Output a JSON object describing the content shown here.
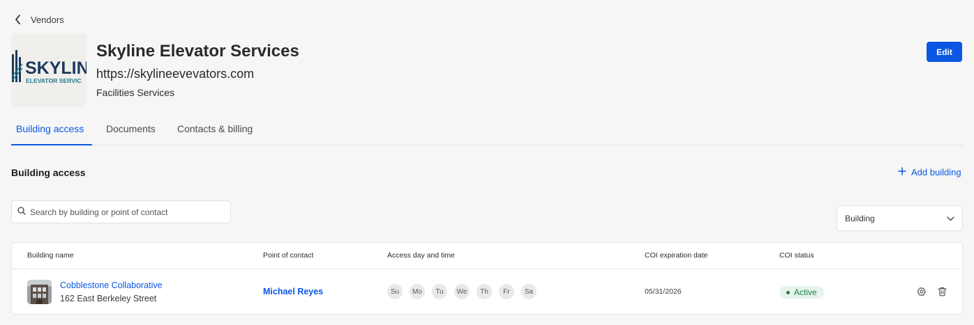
{
  "breadcrumb": {
    "back_label": "Vendors"
  },
  "vendor": {
    "logo_text_top": "SKYLIN",
    "logo_text_bottom": "ELEVATOR SERVIC",
    "name": "Skyline Elevator Services",
    "url": "https://skylineevevators.com",
    "category": "Facilities Services"
  },
  "header": {
    "edit_label": "Edit"
  },
  "tabs": [
    {
      "label": "Building access",
      "active": true
    },
    {
      "label": "Documents",
      "active": false
    },
    {
      "label": "Contacts & billing",
      "active": false
    }
  ],
  "section": {
    "title": "Building access",
    "add_label": "Add building"
  },
  "search": {
    "placeholder": "Search by building or point of contact"
  },
  "filter": {
    "selected": "Building"
  },
  "table": {
    "columns": [
      "Building name",
      "Point of contact",
      "Access day and time",
      "COI expiration date",
      "COI status"
    ],
    "rows": [
      {
        "building_name": "Cobblestone Collaborative",
        "address": "162 East Berkeley Street",
        "contact": "Michael Reyes",
        "days": [
          "Su",
          "Mo",
          "Tu",
          "We",
          "Th",
          "Fr",
          "Sa"
        ],
        "coi_date": "05/31/2026",
        "coi_status": "Active"
      }
    ]
  },
  "colors": {
    "accent": "#0b57e3",
    "status_active_bg": "#e6f4ec",
    "status_active_text": "#1e7d43",
    "logo_navy": "#1c3a5e",
    "logo_teal": "#1f7a86"
  },
  "icons": {
    "back": "chevron-left-icon",
    "add": "plus-icon",
    "search": "search-icon",
    "select": "chevron-down-icon",
    "settings": "gear-icon",
    "delete": "trash-icon"
  }
}
